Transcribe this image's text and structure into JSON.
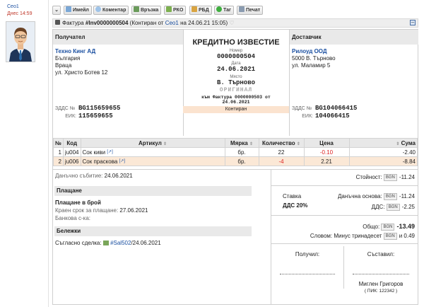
{
  "sidebar": {
    "user": "Сео1",
    "date": "Днес 14:59"
  },
  "toolbar": {
    "email": "Имейл",
    "comment": "Коментар",
    "link": "Връзка",
    "rko": "РКО",
    "rbd": "РБД",
    "tag": "Таг",
    "print": "Печат"
  },
  "titlebar": {
    "prefix": "Фактура",
    "number": "#Inv0000000504",
    "middle": "(Контиран от",
    "author": "Сео1",
    "suffix": "на 24.06.21 15:05)"
  },
  "document": {
    "type": "КРЕДИТНО ИЗВЕСТИЕ",
    "number_label": "Номер",
    "number": "0000000504",
    "date_label": "Дата",
    "date": "24.06.2021",
    "place_label": "Място",
    "place": "В. Търново",
    "original": "ОРИГИНАЛ",
    "to_invoice": "към Фактура 0000000503 от",
    "to_invoice_date": "24.06.2021",
    "status": "Контиран"
  },
  "recipient": {
    "header": "Получател",
    "name": "Техно Кинг АД",
    "country": "България",
    "city": "Враца",
    "address": "ул. Христо Ботев 12",
    "vat_label": "ЗДДС №",
    "vat": "BG115659655",
    "eik_label": "ЕИК:",
    "eik": "115659655"
  },
  "supplier": {
    "header": "Доставчик",
    "name": "Рилоуд ООД",
    "city": "5000 В. Търново",
    "address": "ул. Маламир 5",
    "vat_label": "ЗДДС №",
    "vat": "BG104066415",
    "eik_label": "ЕИК:",
    "eik": "104066415"
  },
  "items": {
    "headers": {
      "no": "№",
      "code": "Код",
      "article": "Артикул",
      "unit": "Мярка",
      "qty": "Количество",
      "price": "Цена",
      "sum": "Сума"
    },
    "rows": [
      {
        "no": "1",
        "code": "ju004",
        "name": "Сок киви",
        "unit": "бр.",
        "qty": "22",
        "price": "-0.10",
        "sum": "-2.40"
      },
      {
        "no": "2",
        "code": "ju006",
        "name": "Сок праскова",
        "unit": "бр.",
        "qty": "-4",
        "price": "2.21",
        "sum": "-8.84"
      }
    ]
  },
  "details": {
    "tax_event_label": "Данъчно събитие:",
    "tax_event": "24.06.2021",
    "payment_header": "Плащане",
    "payment_method": "Плащане в брой",
    "due_label": "Краен срок за плащане:",
    "due": "27.06.2021",
    "bank_label": "Банкова с-ка:",
    "notes_header": "Бележки",
    "note_prefix": "Съгласно сделка:",
    "note_link": "#Sal502",
    "note_suffix": "/24.06.2021"
  },
  "totals": {
    "currency": "BGN",
    "value_label": "Стойност:",
    "value": "-11.24",
    "rate_label": "Ставка",
    "rate": "ДДС 20%",
    "base_label": "Данъчна основа:",
    "base": "-11.24",
    "vat_label": "ДДС:",
    "vat": "-2.25",
    "total_label": "Общо:",
    "total": "-13.49",
    "words_label": "Словом:",
    "words": "Минус тринадесет",
    "words_tail": "и 0.49"
  },
  "signatures": {
    "received_label": "Получил:",
    "composed_label": "Съставил:",
    "composer": "Миглен Григоров",
    "composer_pik": "( ПИК: 122342 )"
  }
}
